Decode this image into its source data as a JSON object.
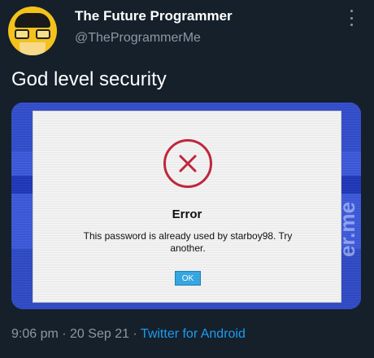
{
  "tweet": {
    "author_name": "The Future Programmer",
    "handle": "@TheProgrammerMe",
    "text": "God level security",
    "time": "9:06 pm",
    "separator": " · ",
    "date": "20 Sep 21",
    "source": "Twitter for Android",
    "more_icon": "more-vertical-icon"
  },
  "avatar": {
    "label": "{0101}"
  },
  "media": {
    "watermark": "er.me",
    "dialog": {
      "icon": "error-x-icon",
      "title": "Error",
      "message": "This password is already used by starboy98. Try another.",
      "ok_label": "OK"
    }
  },
  "colors": {
    "background": "#15202b",
    "link": "#1d9bf0",
    "muted": "#8b98a5",
    "error_red": "#c0283e",
    "ok_blue": "#37a8e3"
  }
}
